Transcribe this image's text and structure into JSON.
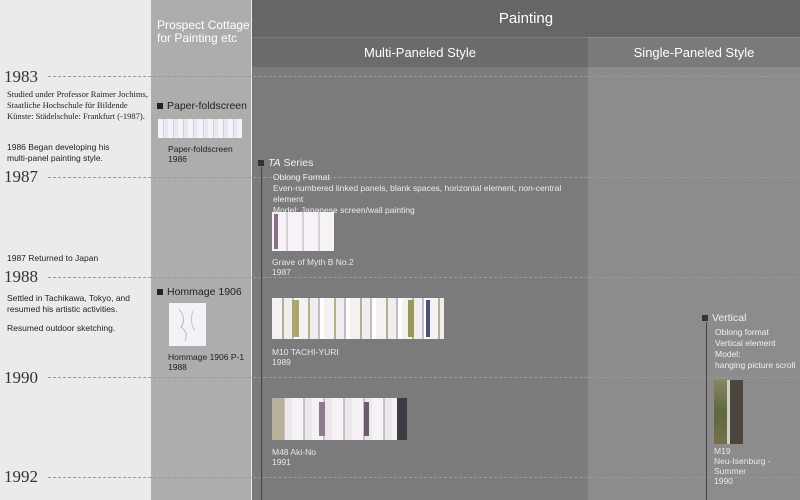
{
  "headers": {
    "prospect": "Prospect Cottage for Painting etc",
    "painting": "Painting",
    "multi": "Multi-Paneled Style",
    "single": "Single-Paneled Style"
  },
  "years": [
    "1983",
    "1987",
    "1988",
    "1990",
    "1992"
  ],
  "bio": {
    "study": "Studied under Professor Raimer Jochims, Staatliche Hochschule für Bildende Künste: Städelschule: Frankfurt (-1987).",
    "began": "1986 Began developing his multi-panel painting style.",
    "returned": "1987 Returned to Japan",
    "settled": "Settled in Tachikawa, Tokyo, and resumed his artistic activities.",
    "sketching": "Resumed outdoor sketching."
  },
  "prospect": {
    "paper_title": "Paper-foldscreen",
    "paper_caption": "Paper-foldscreen",
    "paper_year": "1986",
    "hommage_title": "Hommage 1906",
    "hommage_caption": "Hommage 1906 P-1",
    "hommage_year": "1988"
  },
  "ta": {
    "title_italic": "TA",
    "title_rest": " Series",
    "format": "Oblong Format",
    "elements": "Even-numbered linked panels, blank spaces, horizontal element, non-central element",
    "model": "Model: Japanese screen/wall painting",
    "work1": "Grave of Myth B No.2",
    "work1_year": "1987",
    "work2": "M10 TACHI-YURI",
    "work2_year": "1989",
    "work3": "M48 Aki-No",
    "work3_year": "1991"
  },
  "vertical": {
    "title": "Vertical",
    "format": "Oblong format",
    "element": "Vertical element",
    "model": "Model:",
    "model2": "hanging picture scroll",
    "work": "M19",
    "work_title": "Neu-Isenburg - Summer",
    "work_year": "1990"
  },
  "colors": {
    "header": "#666666",
    "left_bg": "#ebebeb",
    "prospect_bg": "#adadad",
    "multi_bg": "#7b7b7b",
    "single_bg": "#8c8c8c"
  }
}
